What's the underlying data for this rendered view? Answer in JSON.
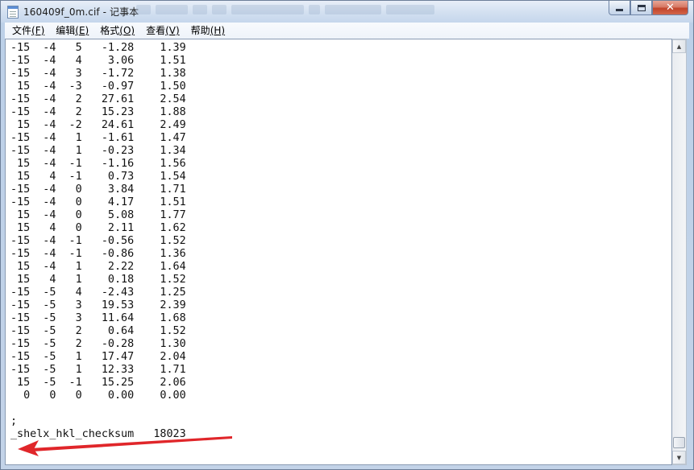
{
  "window": {
    "title": "160409f_0m.cif - 记事本",
    "controls": {
      "close_glyph": "✕"
    }
  },
  "menubar": {
    "items": [
      {
        "label": "文件",
        "key": "(F)"
      },
      {
        "label": "编辑",
        "key": "(E)"
      },
      {
        "label": "格式",
        "key": "(O)"
      },
      {
        "label": "查看",
        "key": "(V)"
      },
      {
        "label": "帮助",
        "key": "(H)"
      }
    ]
  },
  "document": {
    "lines": [
      "-15  -4   5   -1.28    1.39",
      "-15  -4   4    3.06    1.51",
      "-15  -4   3   -1.72    1.38",
      " 15  -4  -3   -0.97    1.50",
      "-15  -4   2   27.61    2.54",
      "-15  -4   2   15.23    1.88",
      " 15  -4  -2   24.61    2.49",
      "-15  -4   1   -1.61    1.47",
      "-15  -4   1   -0.23    1.34",
      " 15  -4  -1   -1.16    1.56",
      " 15   4  -1    0.73    1.54",
      "-15  -4   0    3.84    1.71",
      "-15  -4   0    4.17    1.51",
      " 15  -4   0    5.08    1.77",
      " 15   4   0    2.11    1.62",
      "-15  -4  -1   -0.56    1.52",
      "-15  -4  -1   -0.86    1.36",
      " 15  -4   1    2.22    1.64",
      " 15   4   1    0.18    1.52",
      "-15  -5   4   -2.43    1.25",
      "-15  -5   3   19.53    2.39",
      "-15  -5   3   11.64    1.68",
      "-15  -5   2    0.64    1.52",
      "-15  -5   2   -0.28    1.30",
      "-15  -5   1   17.47    2.04",
      "-15  -5   1   12.33    1.71",
      " 15  -5  -1   15.25    2.06",
      "  0   0   0    0.00    0.00",
      "",
      ";",
      "_shelx_hkl_checksum   18023"
    ]
  },
  "scrollbar": {
    "up_glyph": "▲",
    "down_glyph": "▼"
  },
  "annotation": {
    "arrow_color": "#e0262a"
  }
}
